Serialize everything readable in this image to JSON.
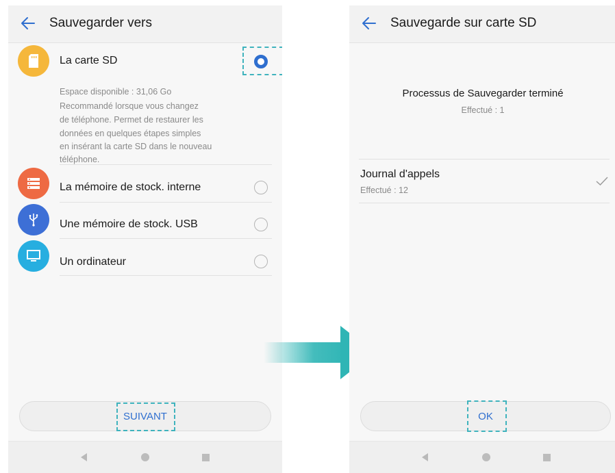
{
  "left_screen": {
    "title": "Sauvegarder vers",
    "options": [
      {
        "label": "La carte SD",
        "selected": true,
        "icon": "sd-card-icon",
        "color": "#f5b73b"
      },
      {
        "label": "La mémoire de stock. interne",
        "selected": false,
        "icon": "storage-icon",
        "color": "#ee6a43"
      },
      {
        "label": "Une mémoire de stock. USB",
        "selected": false,
        "icon": "usb-icon",
        "color": "#3d6fd6"
      },
      {
        "label": "Un ordinateur",
        "selected": false,
        "icon": "monitor-icon",
        "color": "#27aee0"
      }
    ],
    "sd_description": [
      "Espace disponible : 31,06  Go",
      "Recommandé lorsque vous changez",
      "de téléphone. Permet de restaurer les",
      "données en quelques étapes simples",
      "en insérant la carte SD dans le nouveau",
      "téléphone."
    ],
    "next_button": "SUIVANT"
  },
  "right_screen": {
    "title": "Sauvegarde sur carte SD",
    "status_title": "Processus de Sauvegarder terminé",
    "status_subtitle": "Effectué : 1",
    "item": {
      "name": "Journal d'appels",
      "detail": "Effectué : 12",
      "icon": "checkmark-icon"
    },
    "ok_button": "OK"
  },
  "colors": {
    "accent": "#2f6fcf",
    "highlight": "#3fb3bd",
    "arrow": "#2fb5b5"
  }
}
